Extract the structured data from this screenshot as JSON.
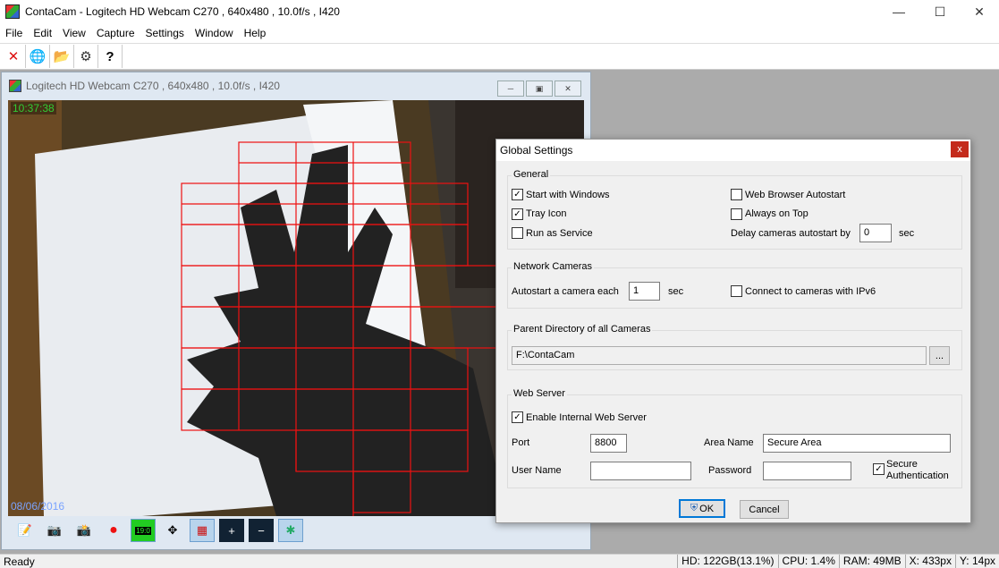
{
  "app": {
    "title": "ContaCam - Logitech HD Webcam C270 , 640x480 , 10.0f/s , I420",
    "menu": [
      "File",
      "Edit",
      "View",
      "Capture",
      "Settings",
      "Window",
      "Help"
    ]
  },
  "child": {
    "title": "Logitech HD Webcam C270 , 640x480 , 10.0f/s , I420",
    "time": "10:37:38",
    "date": "08/06/2016"
  },
  "status": {
    "ready": "Ready",
    "hd": "HD: 122GB(13.1%)",
    "cpu": "CPU: 1.4%",
    "ram": "RAM: 49MB",
    "x": "X: 433px",
    "y": "Y: 14px"
  },
  "dialog": {
    "title": "Global Settings",
    "close": "x",
    "general": {
      "label": "General",
      "start_with_windows": "Start with Windows",
      "tray_icon": "Tray Icon",
      "run_as_service": "Run as Service",
      "web_browser_autostart": "Web Browser Autostart",
      "always_on_top": "Always on Top",
      "delay_label": "Delay cameras autostart by",
      "delay_value": "0",
      "delay_unit": "sec"
    },
    "network": {
      "label": "Network Cameras",
      "autostart_label": "Autostart a camera each",
      "autostart_value": "1",
      "autostart_unit": "sec",
      "ipv6": "Connect to cameras with IPv6"
    },
    "parent_dir": {
      "label": "Parent Directory of all Cameras",
      "value": "F:\\ContaCam",
      "browse": "..."
    },
    "web_server": {
      "label": "Web Server",
      "enable": "Enable Internal Web Server",
      "port_label": "Port",
      "port_value": "8800",
      "area_label": "Area Name",
      "area_value": "Secure Area",
      "user_label": "User Name",
      "user_value": "",
      "password_label": "Password",
      "password_value": "",
      "secure_auth_line1": "Secure",
      "secure_auth_line2": "Authentication"
    },
    "ok": "OK",
    "cancel": "Cancel"
  }
}
